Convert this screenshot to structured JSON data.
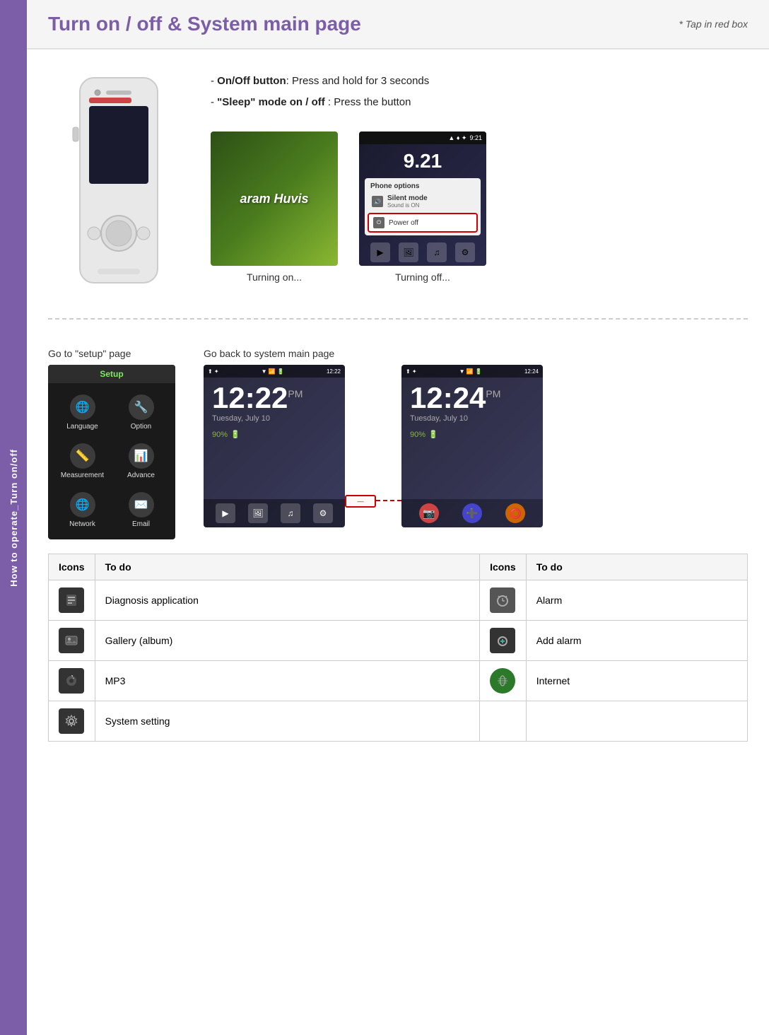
{
  "sidebar": {
    "label": "How to operate_Turn on/off"
  },
  "header": {
    "title": "Turn on / off & System main page",
    "note": "* Tap in red box"
  },
  "section1": {
    "instructions": [
      "- On/Off button: Press and hold for 3 seconds",
      "- \"Sleep\" mode on / off : Press the button"
    ],
    "screen1_caption": "Turning on...",
    "screen2_caption": "Turning off...",
    "screen1_brand": "aram Huvis",
    "screen2_time": "9:21",
    "screen2_big_time": "9.21",
    "screen2_phone_options": "Phone options",
    "screen2_silent_mode": "Silent mode",
    "screen2_sound_on": "Sound is ON",
    "screen2_power_off": "Power off"
  },
  "section2": {
    "setup_label": "Go to \"setup\" page",
    "main_page_label": "Go back to system main page",
    "setup_title": "Setup",
    "setup_items": [
      {
        "label": "Language",
        "icon": "🌐"
      },
      {
        "label": "Option",
        "icon": "🔧"
      },
      {
        "label": "Measurement",
        "icon": "📏"
      },
      {
        "label": "Advance",
        "icon": "📊"
      },
      {
        "label": "Network",
        "icon": "🌐"
      },
      {
        "label": "Email",
        "icon": "✉️"
      }
    ],
    "screen1_time": "12:22",
    "screen1_date": "Tuesday, July 10",
    "screen1_battery": "90%",
    "screen2_time": "12:24",
    "screen2_date": "Tuesday, July 10",
    "screen2_battery": "90%"
  },
  "table": {
    "headers": [
      "Icons",
      "To do",
      "Icons",
      "To do"
    ],
    "rows": [
      {
        "icon1": "diag",
        "desc1": "Diagnosis application",
        "icon2": "alarm",
        "desc2": "Alarm"
      },
      {
        "icon1": "gallery",
        "desc1": "Gallery (album)",
        "icon2": "add-alarm",
        "desc2": "Add alarm"
      },
      {
        "icon1": "mp3",
        "desc1": "MP3",
        "icon2": "internet",
        "desc2": "Internet"
      },
      {
        "icon1": "settings",
        "desc1": "System setting",
        "icon2": "",
        "desc2": ""
      }
    ]
  }
}
